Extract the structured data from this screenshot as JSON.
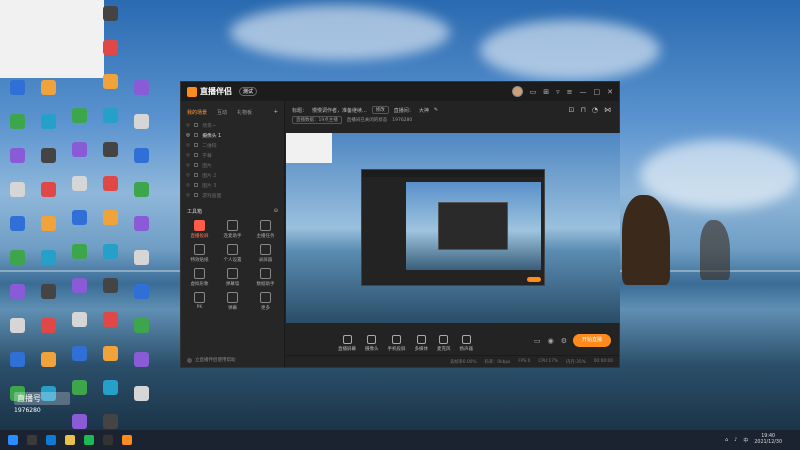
{
  "app": {
    "title": "直播伴侣",
    "version": "测试",
    "window_controls": [
      "—",
      "□",
      "✕"
    ]
  },
  "left_panel": {
    "tabs": [
      "我的场景",
      "互动",
      "礼物板"
    ],
    "scenes": [
      {
        "label": "场景一",
        "active": false
      },
      {
        "label": "摄像头 1",
        "active": true
      },
      {
        "label": "二维码",
        "active": false
      },
      {
        "label": "字幕",
        "active": false
      },
      {
        "label": "图片",
        "active": false
      },
      {
        "label": "图片 2",
        "active": false
      },
      {
        "label": "图片 3",
        "active": false
      },
      {
        "label": "游戏画面",
        "active": false
      }
    ],
    "tools_title": "工具箱",
    "tools": [
      {
        "label": "直播投屏",
        "hot": true
      },
      {
        "label": "连麦助手",
        "hot": false
      },
      {
        "label": "主播任务",
        "hot": false
      },
      {
        "label": "特效贴纸",
        "hot": false
      },
      {
        "label": "个人设置",
        "hot": false
      },
      {
        "label": "录屏器",
        "hot": false
      },
      {
        "label": "虚拟形象",
        "hot": false
      },
      {
        "label": "弹幕墙",
        "hot": false
      },
      {
        "label": "数据助手",
        "hot": false
      },
      {
        "label": "PK",
        "hot": false
      },
      {
        "label": "弹幕",
        "hot": false
      },
      {
        "label": "更多",
        "hot": false
      }
    ],
    "bottom_text": "立直播伴侣使用帮助"
  },
  "info": {
    "title_label": "标题：",
    "title_value": "慢慢调作者，准备继续...",
    "edit_chip": "修改",
    "room_label": "直播间：",
    "room_value": "大神",
    "row2_a": "直播数据：19点主播",
    "row2_b": "直播间已关闭的状态",
    "row2_c": "1976280"
  },
  "controls": [
    {
      "label": "直播屏幕"
    },
    {
      "label": "摄像头"
    },
    {
      "label": "手机投屏"
    },
    {
      "label": "多媒体"
    },
    {
      "label": "麦克风"
    },
    {
      "label": "扬声器"
    }
  ],
  "start_button": "开始直播",
  "status": [
    "丢帧率0.00%",
    "码率：0kbps",
    "FPS:0",
    "CPU:17%",
    "内存:35%",
    "00:00:00"
  ],
  "watermark": {
    "line1": "直播号",
    "line2": "1976280"
  },
  "taskbar": {
    "time": "19:40",
    "date": "2021/12/30",
    "lang": "中"
  },
  "colors": {
    "accent": "#ff8a1e",
    "panel": "#232324"
  }
}
